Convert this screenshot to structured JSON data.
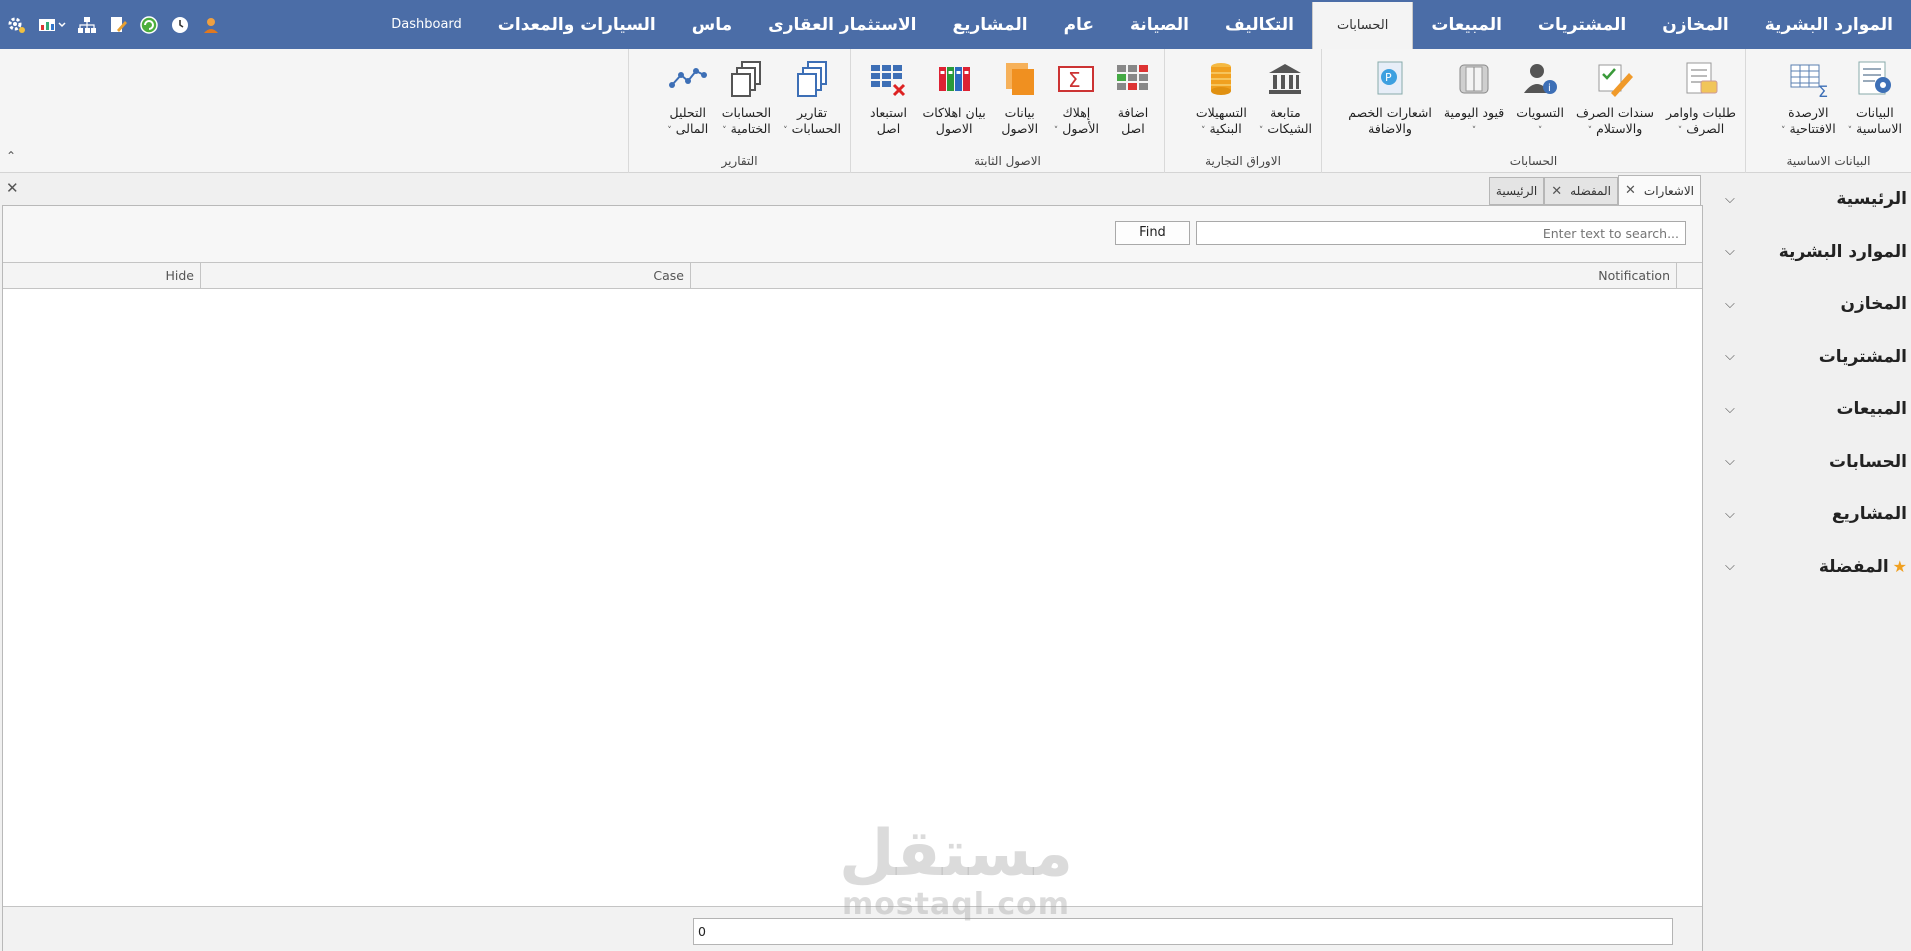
{
  "menu": {
    "tabs": [
      {
        "label": "الموارد البشرية"
      },
      {
        "label": "المخازن"
      },
      {
        "label": "المشتريات"
      },
      {
        "label": "المبيعات"
      },
      {
        "label": "الحسابات",
        "active": true
      },
      {
        "label": "التكاليف"
      },
      {
        "label": "الصيانة"
      },
      {
        "label": "عام"
      },
      {
        "label": "المشاريع"
      },
      {
        "label": "الاستثمار العقارى"
      },
      {
        "label": "ماس"
      },
      {
        "label": "السيارات والمعدات"
      },
      {
        "label": "Dashboard"
      }
    ],
    "quick_access_icons": [
      "settings-gear-icon",
      "chart-dropdown-icon",
      "network-icon",
      "document-edit-icon",
      "refresh-green-icon",
      "clock-icon",
      "user-icon"
    ]
  },
  "ribbon": {
    "groups": [
      {
        "title": "البيانات الاساسية",
        "buttons": [
          {
            "line1": "البيانات",
            "line2": "الاساسية",
            "dropdown": true
          },
          {
            "line1": "الارصدة",
            "line2": "الافتتاحية",
            "dropdown": true
          }
        ]
      },
      {
        "title": "الحسابات",
        "buttons": [
          {
            "line1": "طلبات واوامر",
            "line2": "الصرف",
            "dropdown": true
          },
          {
            "line1": "سندات الصرف",
            "line2": "والاستلام",
            "dropdown": true
          },
          {
            "line1": "التسويات",
            "line2": "",
            "dropdown": true
          },
          {
            "line1": "قيود اليومية",
            "line2": "",
            "dropdown": true
          },
          {
            "line1": "اشعارات الخصم",
            "line2": "والاضافة",
            "dropdown": false
          }
        ]
      },
      {
        "title": "الاوراق التجارية",
        "buttons": [
          {
            "line1": "متابعة",
            "line2": "الشيكات",
            "dropdown": true
          },
          {
            "line1": "التسهيلات",
            "line2": "البنكية",
            "dropdown": true
          }
        ]
      },
      {
        "title": "الاصول الثابتة",
        "buttons": [
          {
            "line1": "اضافة",
            "line2": "اصل",
            "dropdown": false
          },
          {
            "line1": "إهلاك",
            "line2": "الأصول",
            "dropdown": true
          },
          {
            "line1": "بيانات",
            "line2": "الاصول",
            "dropdown": false
          },
          {
            "line1": "بيان اهلاكات",
            "line2": "الاصول",
            "dropdown": false
          },
          {
            "line1": "استبعاد",
            "line2": "اصل",
            "dropdown": false
          }
        ]
      },
      {
        "title": "التقارير",
        "buttons": [
          {
            "line1": "تقارير",
            "line2": "الحسابات",
            "dropdown": true
          },
          {
            "line1": "الحسابات",
            "line2": "الختامية",
            "dropdown": true
          },
          {
            "line1": "التحليل",
            "line2": "المالى",
            "dropdown": true
          }
        ]
      }
    ]
  },
  "sidenav": {
    "items": [
      {
        "label": "الرئيسية"
      },
      {
        "label": "الموارد البشرية"
      },
      {
        "label": "المخازن"
      },
      {
        "label": "المشتريات"
      },
      {
        "label": "المبيعات"
      },
      {
        "label": "الحسابات"
      },
      {
        "label": "المشاريع"
      },
      {
        "label": "المفضلة",
        "icon": "star-icon"
      }
    ]
  },
  "doc_tabs": [
    {
      "label": "الرئيسية",
      "closable": false
    },
    {
      "label": "المفضله",
      "closable": true
    },
    {
      "label": "الاشعارات",
      "closable": true,
      "active": true
    }
  ],
  "search": {
    "placeholder": "Enter text to search...",
    "find_label": "Find"
  },
  "grid": {
    "columns": [
      "Notification",
      "Case",
      "Hide"
    ],
    "rows": []
  },
  "footer": {
    "count": "0"
  },
  "watermark": {
    "arabic": "مستقل",
    "latin": "mostaql.com"
  },
  "colors": {
    "menu_bar": "#4b6da7",
    "ribbon": "#f5f5f5",
    "panel": "#f7f7f7"
  }
}
